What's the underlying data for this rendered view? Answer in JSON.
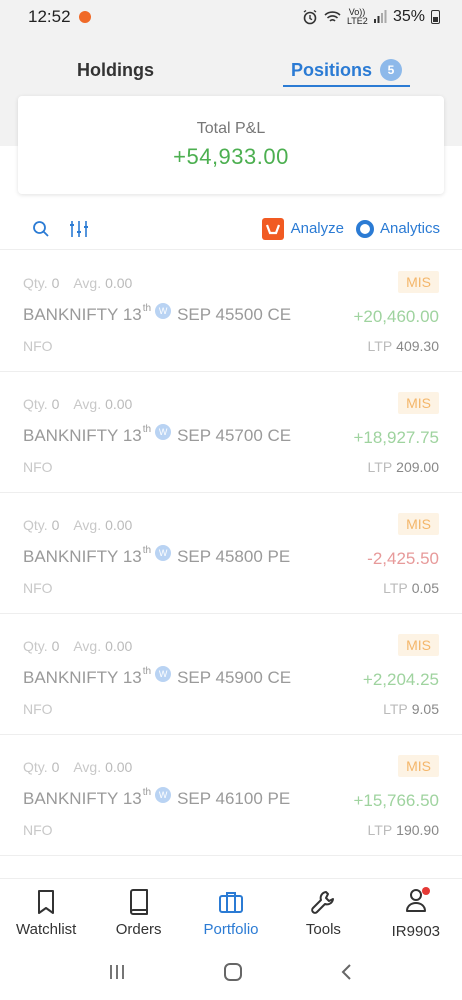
{
  "status_bar": {
    "time": "12:52",
    "network_label": "Vo)) LTE2",
    "battery": "35%"
  },
  "tabs": [
    {
      "label": "Holdings"
    },
    {
      "label": "Positions",
      "badge": "5"
    }
  ],
  "summary": {
    "label": "Total P&L",
    "value": "+54,933.00"
  },
  "toolbar": {
    "analyze_label": "Analyze",
    "analytics_label": "Analytics"
  },
  "positions": [
    {
      "qty_label": "Qty.",
      "qty": "0",
      "avg_label": "Avg.",
      "avg": "0.00",
      "product": "MIS",
      "symbol": "BANKNIFTY 13",
      "suffix": "th",
      "week": "W",
      "contract": "SEP 45500 CE",
      "pnl": "+20,460.00",
      "exchange": "NFO",
      "ltp_label": "LTP",
      "ltp": "409.30"
    },
    {
      "qty_label": "Qty.",
      "qty": "0",
      "avg_label": "Avg.",
      "avg": "0.00",
      "product": "MIS",
      "symbol": "BANKNIFTY 13",
      "suffix": "th",
      "week": "W",
      "contract": "SEP 45700 CE",
      "pnl": "+18,927.75",
      "exchange": "NFO",
      "ltp_label": "LTP",
      "ltp": "209.00"
    },
    {
      "qty_label": "Qty.",
      "qty": "0",
      "avg_label": "Avg.",
      "avg": "0.00",
      "product": "MIS",
      "symbol": "BANKNIFTY 13",
      "suffix": "th",
      "week": "W",
      "contract": "SEP 45800 PE",
      "pnl": "-2,425.50",
      "exchange": "NFO",
      "ltp_label": "LTP",
      "ltp": "0.05"
    },
    {
      "qty_label": "Qty.",
      "qty": "0",
      "avg_label": "Avg.",
      "avg": "0.00",
      "product": "MIS",
      "symbol": "BANKNIFTY 13",
      "suffix": "th",
      "week": "W",
      "contract": "SEP 45900 CE",
      "pnl": "+2,204.25",
      "exchange": "NFO",
      "ltp_label": "LTP",
      "ltp": "9.05"
    },
    {
      "qty_label": "Qty.",
      "qty": "0",
      "avg_label": "Avg.",
      "avg": "0.00",
      "product": "MIS",
      "symbol": "BANKNIFTY 13",
      "suffix": "th",
      "week": "W",
      "contract": "SEP 46100 PE",
      "pnl": "+15,766.50",
      "exchange": "NFO",
      "ltp_label": "LTP",
      "ltp": "190.90"
    }
  ],
  "bottom_nav": [
    {
      "label": "Watchlist",
      "icon": "bookmark-icon"
    },
    {
      "label": "Orders",
      "icon": "book-icon"
    },
    {
      "label": "Portfolio",
      "icon": "briefcase-icon",
      "active": true
    },
    {
      "label": "Tools",
      "icon": "wrench-icon"
    },
    {
      "label": "IR9903",
      "icon": "user-icon"
    }
  ],
  "colors": {
    "accent": "#2b7bd4",
    "profit": "#4caf50",
    "loss": "#e57373",
    "badge_bg": "#fdf3e4",
    "badge_text": "#f4b66a",
    "analyze_brand": "#f15a22"
  }
}
